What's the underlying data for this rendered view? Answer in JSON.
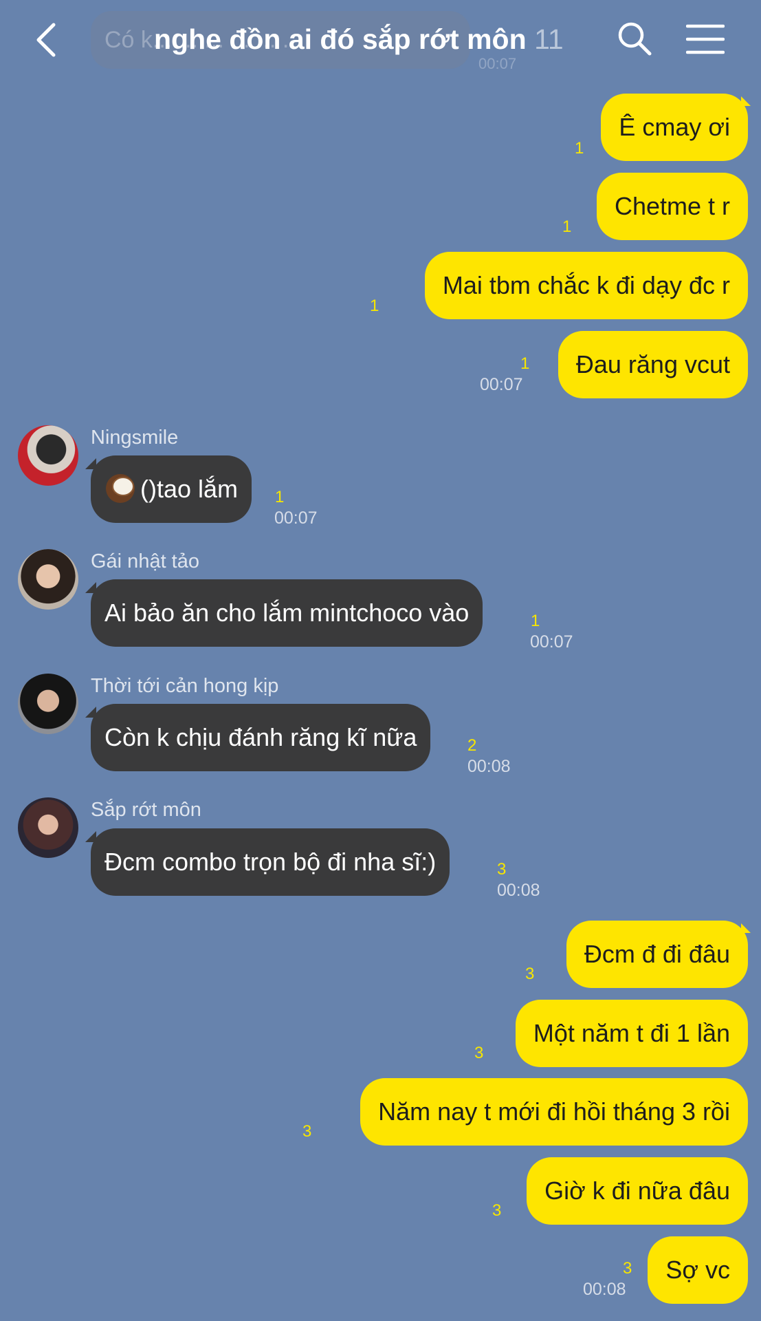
{
  "header": {
    "title": "nghe đồn ai đó sắp rớt môn",
    "member_count": "11",
    "ghost_message": "Có k... ... ... ... ... ...",
    "ghost_time": "00:07"
  },
  "messages": [
    {
      "from": "me",
      "text": "Ê cmay ơi",
      "unread": "1"
    },
    {
      "from": "me",
      "text": "Chetme t r",
      "unread": "1"
    },
    {
      "from": "me",
      "text": "Mai tbm chắc k đi dạy đc r",
      "unread": "1"
    },
    {
      "from": "me",
      "text": "Đau răng vcut",
      "unread": "1",
      "time": "00:07"
    },
    {
      "from": "other",
      "sender": "Ningsmile",
      "text": "()tao lắm",
      "emoji": "coconut-icon",
      "unread": "1",
      "time": "00:07"
    },
    {
      "from": "other",
      "sender": "Gái nhật tảo",
      "text": "Ai bảo ăn cho lắm mintchoco vào",
      "unread": "1",
      "time": "00:07"
    },
    {
      "from": "other",
      "sender": "Thời tới cản hong kịp",
      "text": "Còn k chịu đánh răng kĩ nữa",
      "unread": "2",
      "time": "00:08"
    },
    {
      "from": "other",
      "sender": "Sắp rớt môn",
      "text": "Đcm combo trọn bộ đi nha sĩ:)",
      "unread": "3",
      "time": "00:08"
    },
    {
      "from": "me",
      "text": "Đcm đ đi đâu",
      "unread": "3"
    },
    {
      "from": "me",
      "text": "Một năm t đi 1 lần",
      "unread": "3"
    },
    {
      "from": "me",
      "text": "Năm nay t mới đi hồi tháng 3 rồi",
      "unread": "3"
    },
    {
      "from": "me",
      "text": "Giờ k đi nữa đâu",
      "unread": "3"
    },
    {
      "from": "me",
      "text": "Sợ vc",
      "unread": "3",
      "time": "00:08"
    }
  ],
  "colors": {
    "background": "#6783ad",
    "my_bubble": "#fee500",
    "other_bubble": "#3a3a3b",
    "unread": "#f7e600"
  }
}
